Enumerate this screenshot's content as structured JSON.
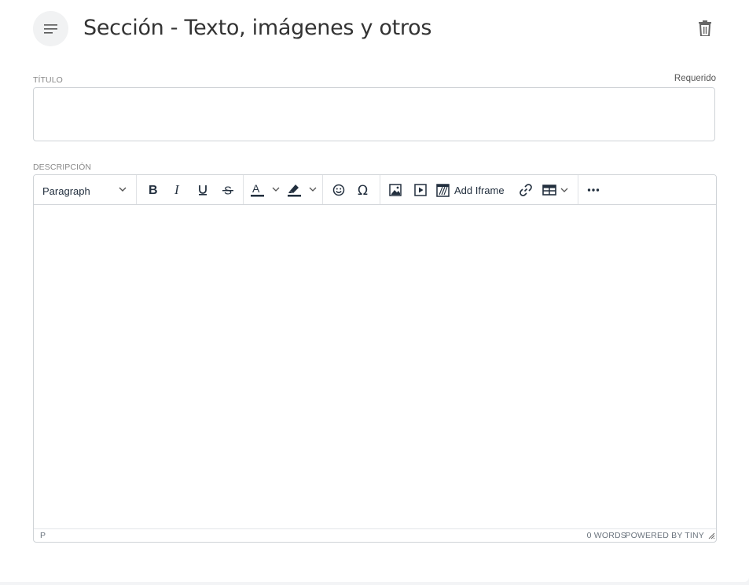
{
  "section": {
    "icon": "subject-lines-icon",
    "title": "Sección - Texto, imágenes y otros",
    "delete_icon": "trash-icon"
  },
  "title_field": {
    "label": "TÍTULO",
    "required_text": "Requerido",
    "value": "",
    "placeholder": ""
  },
  "description_field": {
    "label": "DESCRIPCIÓN"
  },
  "editor": {
    "block_format": "Paragraph",
    "toolbar": {
      "bold": "bold-icon",
      "italic": "italic-icon",
      "underline": "underline-icon",
      "strikethrough": "strikethrough-icon",
      "text_color": "text-color-icon",
      "highlight": "highlight-icon",
      "emoji": "emoji-icon",
      "special_char": "omega-icon",
      "image": "image-icon",
      "media": "media-icon",
      "add_iframe_label": "Add Iframe",
      "link": "link-icon",
      "table": "table-icon",
      "more": "more-icon"
    },
    "status": {
      "path": "P",
      "word_count": "0 WORDS",
      "powered_by": "POWERED BY TINY"
    }
  },
  "colors": {
    "text_color_bar": "#222f3e",
    "border": "#cfd3d7"
  }
}
